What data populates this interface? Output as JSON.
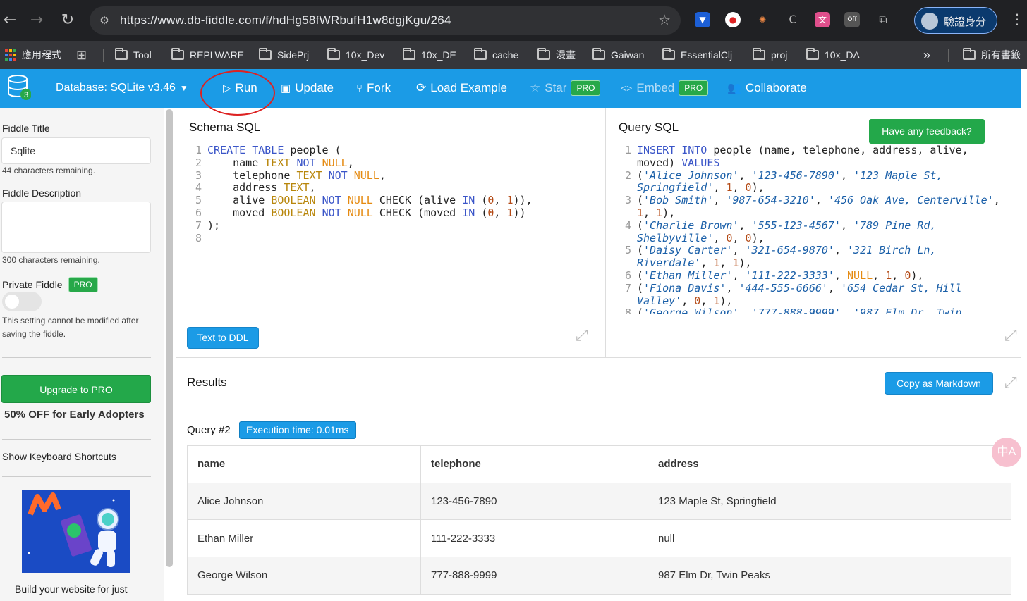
{
  "browser": {
    "url": "https://www.db-fiddle.com/f/hdHg58fWRbufH1w8dgjKgu/264",
    "profile_label": "驗證身分",
    "ext_off_label": "Off"
  },
  "bookmarks": {
    "apps_label": "應用程式",
    "items": [
      "Tool",
      "REPLWARE",
      "SidePrj",
      "10x_Dev",
      "10x_DE",
      "cache",
      "漫畫",
      "Gaiwan",
      "EssentialClj",
      "proj",
      "10x_DA"
    ],
    "more_label": "»",
    "all_label": "所有書籤"
  },
  "toolbar": {
    "db_count": "3",
    "database_label": "Database: SQLite v3.46",
    "run": "Run",
    "update": "Update",
    "fork": "Fork",
    "load_example": "Load Example",
    "star": "Star",
    "star_badge": "PRO",
    "embed": "Embed",
    "embed_badge": "PRO",
    "collaborate": "Collaborate"
  },
  "sidebar": {
    "fiddle_title_label": "Fiddle Title",
    "fiddle_title_value": "Sqlite",
    "title_remaining": "44 characters remaining.",
    "fiddle_description_label": "Fiddle Description",
    "description_value": "",
    "description_remaining": "300 characters remaining.",
    "private_label": "Private Fiddle",
    "private_badge": "PRO",
    "private_note_1": "This setting cannot be modified after",
    "private_note_2": "saving the fiddle.",
    "upgrade_button": "Upgrade to PRO",
    "promo": "50% OFF for Early Adopters",
    "shortcuts": "Show Keyboard Shortcuts",
    "ad_caption": "Build your website for just"
  },
  "schema": {
    "title": "Schema SQL",
    "text_to_ddl": "Text to DDL"
  },
  "query": {
    "title": "Query SQL",
    "feedback": "Have any feedback?"
  },
  "results": {
    "title": "Results",
    "copy_markdown": "Copy as Markdown",
    "query_label": "Query #2",
    "execution_time": "Execution time: 0.01ms",
    "columns": [
      "name",
      "telephone",
      "address"
    ],
    "rows": [
      [
        "Alice Johnson",
        "123-456-7890",
        "123 Maple St, Springfield"
      ],
      [
        "Ethan Miller",
        "111-222-3333",
        "null"
      ],
      [
        "George Wilson",
        "777-888-9999",
        "987 Elm Dr, Twin Peaks"
      ]
    ]
  },
  "translate_label": "中A"
}
